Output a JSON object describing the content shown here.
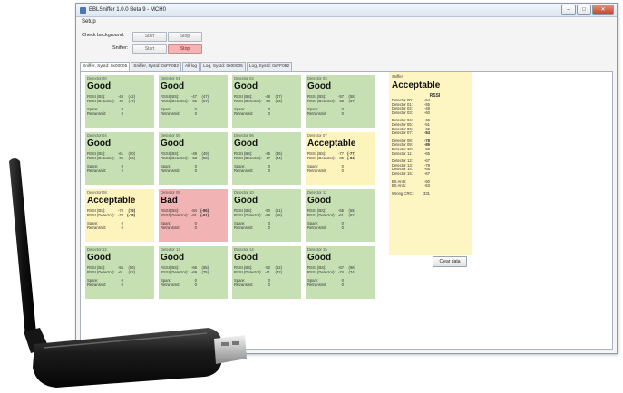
{
  "window": {
    "title": "EBLSniffer 1.0.0 Beta 9 - MCH0",
    "min": "–",
    "max": "□",
    "close": "✕"
  },
  "menu": {
    "setup": "Setup"
  },
  "controls": {
    "check_background_label": "Check background:",
    "check_background_start": "Start",
    "check_background_stop": "Stop",
    "sniffer_label": "Sniffer:",
    "sniffer_start": "Start",
    "sniffer_stop": "Stop"
  },
  "tabs": [
    "Sniffer, SysId: 0x00005",
    "Sniffer, SysId: 0xFF082",
    "All log",
    "Log, SysId: 0x00005",
    "Log, SysId: 0xFF082"
  ],
  "labels": {
    "rssi_bs": "RSSI (BS):",
    "rssi_det": "RSSI (Detector):",
    "spare": "Spare:",
    "retransmit": "Retransmit:"
  },
  "detectors": [
    {
      "name": "Detector 00",
      "status": "Good",
      "state": "good",
      "bs": "-43",
      "bs_avg": "(42)",
      "det": "-49",
      "det_avg": "(47)",
      "spare": "0",
      "retransmit": "0"
    },
    {
      "name": "Detector 01",
      "status": "Good",
      "state": "good",
      "bs": "-47",
      "bs_avg": "(47)",
      "det": "-55",
      "det_avg": "(57)",
      "spare": "0",
      "retransmit": "0"
    },
    {
      "name": "Detector 02",
      "status": "Good",
      "state": "good",
      "bs": "-48",
      "bs_avg": "(47)",
      "det": "-53",
      "det_avg": "(53)",
      "spare": "0",
      "retransmit": "0"
    },
    {
      "name": "Detector 03",
      "status": "Good",
      "state": "good",
      "bs": "-57",
      "bs_avg": "(58)",
      "det": "-68",
      "det_avg": "(67)",
      "spare": "0",
      "retransmit": "0"
    },
    {
      "name": "Detector 04",
      "status": "Good",
      "state": "good",
      "bs": "-61",
      "bs_avg": "(60)",
      "det": "-66",
      "det_avg": "(66)",
      "spare": "0",
      "retransmit": "2"
    },
    {
      "name": "Detector 05",
      "status": "Good",
      "state": "good",
      "bs": "-49",
      "bs_avg": "(49)",
      "det": "-53",
      "det_avg": "(53)",
      "spare": "0",
      "retransmit": "0"
    },
    {
      "name": "Detector 06",
      "status": "Good",
      "state": "good",
      "bs": "-45",
      "bs_avg": "(46)",
      "det": "-47",
      "det_avg": "(44)",
      "spare": "0",
      "retransmit": "0"
    },
    {
      "name": "Detector 07",
      "status": "Acceptable",
      "state": "acceptable",
      "bs": "-77",
      "bs_avg": "(-77)",
      "det": "-85",
      "det_avg": "(-84)",
      "spare": "0",
      "retransmit": "0"
    },
    {
      "name": "Detector 08",
      "status": "Acceptable",
      "state": "acceptable",
      "bs": "-78",
      "bs_avg": "(75)",
      "det": "-78",
      "det_avg": "(-78)",
      "spare": "0",
      "retransmit": "0"
    },
    {
      "name": "Detector 09",
      "status": "Bad",
      "state": "bad",
      "bs": "-84",
      "bs_avg": "(-85)",
      "det": "-91",
      "det_avg": "(-91)",
      "spare": "0",
      "retransmit": "0"
    },
    {
      "name": "Detector 10",
      "status": "Good",
      "state": "good",
      "bs": "-50",
      "bs_avg": "(51)",
      "det": "-58",
      "det_avg": "(56)",
      "spare": "0",
      "retransmit": "0"
    },
    {
      "name": "Detector 11",
      "status": "Good",
      "state": "good",
      "bs": "-55",
      "bs_avg": "(55)",
      "det": "-61",
      "det_avg": "(62)",
      "spare": "0",
      "retransmit": "0"
    },
    {
      "name": "Detector 12",
      "status": "Good",
      "state": "good",
      "bs": "-56",
      "bs_avg": "(56)",
      "det": "-61",
      "det_avg": "(62)",
      "spare": "0",
      "retransmit": "0"
    },
    {
      "name": "Detector 13",
      "status": "Good",
      "state": "good",
      "bs": "-66",
      "bs_avg": "(65)",
      "det": "-69",
      "det_avg": "(75)",
      "spare": "0",
      "retransmit": "0"
    },
    {
      "name": "Detector 14",
      "status": "Good",
      "state": "good",
      "bs": "-52",
      "bs_avg": "(52)",
      "det": "-41",
      "det_avg": "(42)",
      "spare": "0",
      "retransmit": "0"
    },
    {
      "name": "Detector 15",
      "status": "Good",
      "state": "good",
      "bs": "-67",
      "bs_avg": "(68)",
      "det": "-74",
      "det_avg": "(74)",
      "spare": "0",
      "retransmit": "0"
    }
  ],
  "sniffer": {
    "title": "Sniffer",
    "status": "Acceptable",
    "rssi_header": "RSSI",
    "groups": [
      [
        {
          "k": "Detector 00:",
          "v": "-54"
        },
        {
          "k": "Detector 01:",
          "v": "-55"
        },
        {
          "k": "Detector 02:",
          "v": "-49"
        },
        {
          "k": "Detector 03:",
          "v": "-60"
        }
      ],
      [
        {
          "k": "Detector 04:",
          "v": "-66"
        },
        {
          "k": "Detector 05:",
          "v": "-51"
        },
        {
          "k": "Detector 06:",
          "v": "-62"
        },
        {
          "k": "Detector 07:",
          "v": "-84",
          "bold": true
        }
      ],
      [
        {
          "k": "Detector 08:",
          "v": "-78",
          "bold": true
        },
        {
          "k": "Detector 09:",
          "v": "-89",
          "bold": true
        },
        {
          "k": "Detector 10:",
          "v": "-50"
        },
        {
          "k": "Detector 11:",
          "v": "-65"
        }
      ],
      [
        {
          "k": "Detector 12:",
          "v": "-67"
        },
        {
          "k": "Detector 13:",
          "v": "-78"
        },
        {
          "k": "Detector 14:",
          "v": "-65"
        },
        {
          "k": "Detector 15:",
          "v": "-67"
        }
      ],
      [
        {
          "k": "BS Ant0:",
          "v": "-50"
        },
        {
          "k": "BS Ant1:",
          "v": "-53"
        }
      ],
      [
        {
          "k": "Wrong CRC:",
          "v": "331"
        }
      ]
    ],
    "clear_button": "Clear data"
  },
  "colors": {
    "good": "#c6e0b4",
    "acceptable": "#fdf3bd",
    "bad": "#f1b3b3",
    "active_stop": "#f3b4b4"
  },
  "icons": {
    "app": "app-icon",
    "antenna": "usb-dongle-image"
  }
}
